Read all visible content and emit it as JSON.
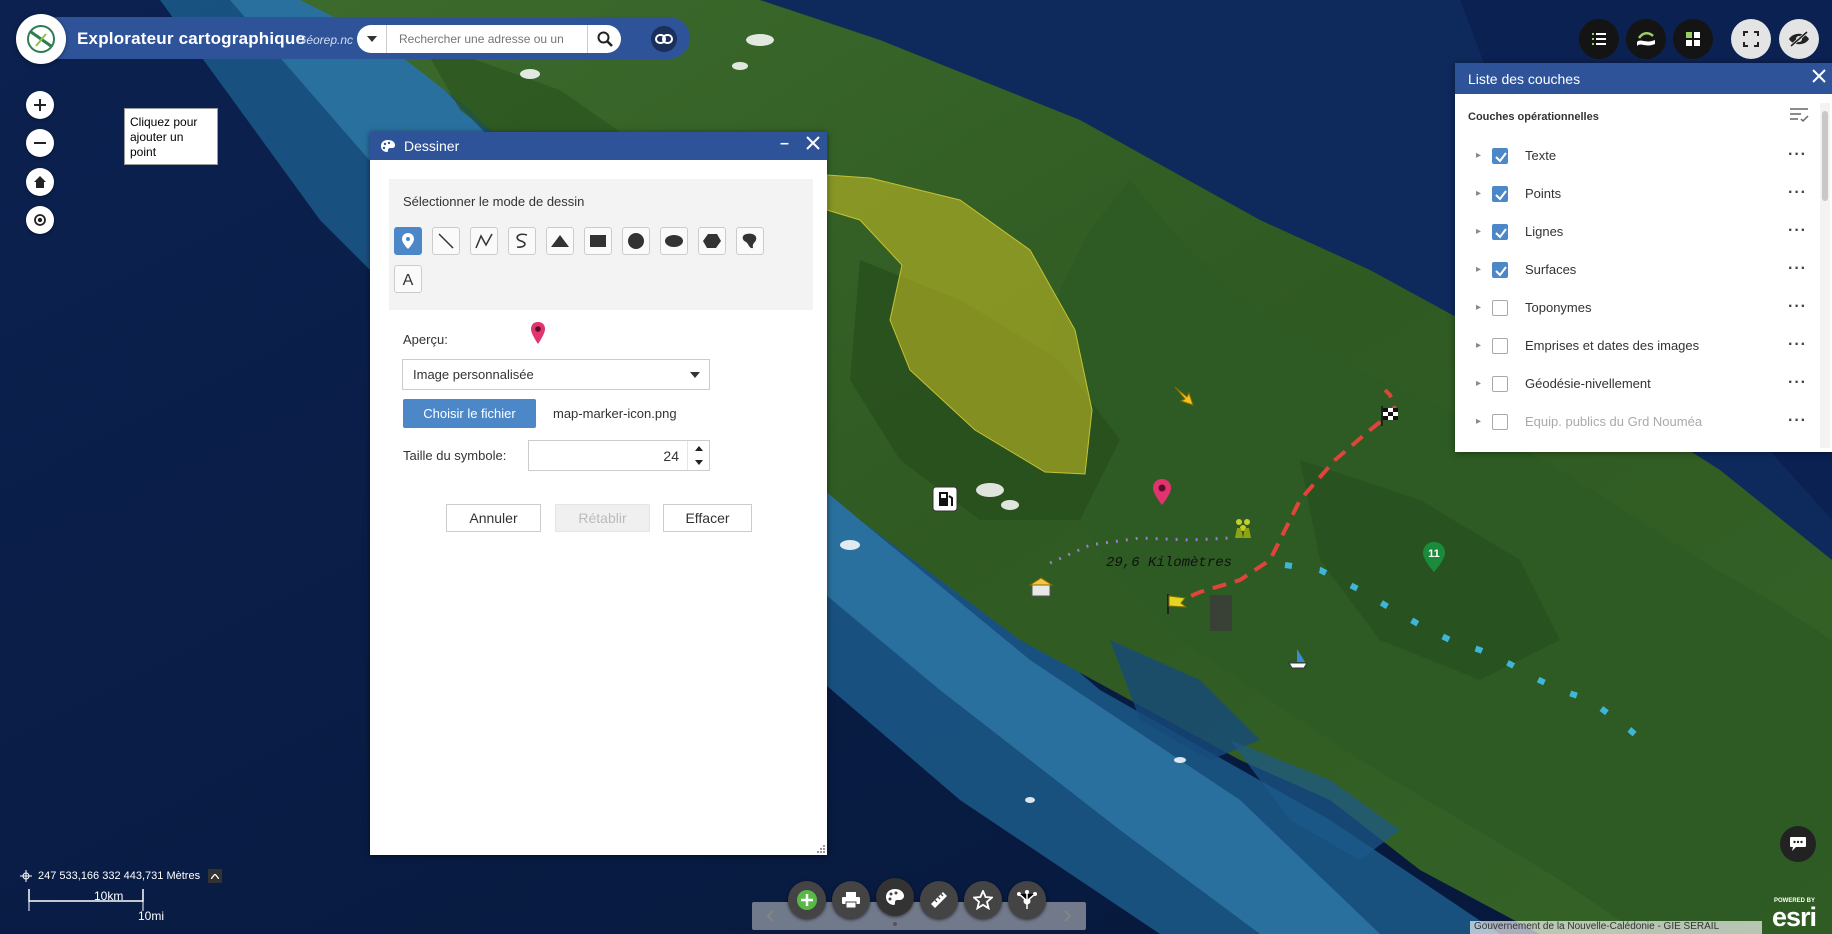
{
  "header": {
    "app_title": "Explorateur cartographique",
    "site": "Géorep.nc",
    "search_placeholder": "Rechercher une adresse ou un"
  },
  "map": {
    "tooltip": "Cliquez pour ajouter un point",
    "measure_label": "29,6 Kilomètres",
    "cluster_count": "11",
    "coordinates": "247 533,166 332 443,731 Mètres",
    "scale_km": "10km",
    "scale_mi": "10mi",
    "attribution": "Gouvernement de la Nouvelle-Calédonie - GIE SERAIL"
  },
  "draw_panel": {
    "title": "Dessiner",
    "mode_label": "Sélectionner le mode de dessin",
    "preview_label": "Aperçu:",
    "symbol_type": "Image personnalisée",
    "choose_file_label": "Choisir le fichier",
    "file_name": "map-marker-icon.png",
    "size_label": "Taille du symbole:",
    "size_value": "24",
    "cancel_label": "Annuler",
    "restore_label": "Rétablir",
    "clear_label": "Effacer"
  },
  "layer_panel": {
    "title": "Liste des couches",
    "section": "Couches opérationnelles",
    "layers": [
      {
        "name": "Texte",
        "checked": true
      },
      {
        "name": "Points",
        "checked": true
      },
      {
        "name": "Lignes",
        "checked": true
      },
      {
        "name": "Surfaces",
        "checked": true
      },
      {
        "name": "Toponymes",
        "checked": false
      },
      {
        "name": "Emprises et dates des images",
        "checked": false
      },
      {
        "name": "Géodésie-nivellement",
        "checked": false
      },
      {
        "name": "Equip. publics du Grd Nouméa",
        "checked": false
      }
    ]
  },
  "branding": {
    "powered_by": "POWERED BY",
    "esri": "esri"
  },
  "colors": {
    "header_blue": "#2e5399",
    "accent_blue": "#4c87c7",
    "marker_pink": "#e0336f",
    "measure_red": "#e0443b"
  }
}
